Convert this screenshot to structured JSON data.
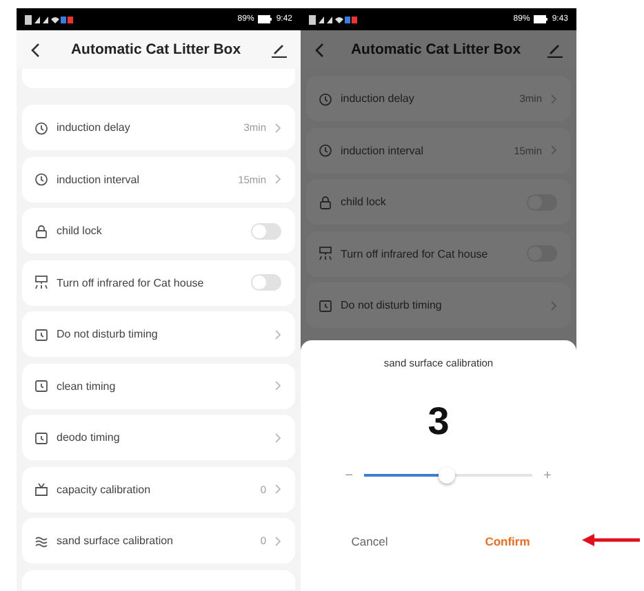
{
  "screens": [
    {
      "status": {
        "battery": "89%",
        "time": "9:42"
      },
      "title": "Automatic Cat Litter Box",
      "rows": [
        {
          "label": "induction delay",
          "kind": "value",
          "value": "3min"
        },
        {
          "label": "induction interval",
          "kind": "value",
          "value": "15min"
        },
        {
          "label": "child lock",
          "kind": "toggle",
          "on": false
        },
        {
          "label": "Turn off infrared for Cat house",
          "kind": "toggle",
          "on": false
        },
        {
          "label": "Do not disturb timing",
          "kind": "link"
        },
        {
          "label": "clean timing",
          "kind": "link"
        },
        {
          "label": "deodo timing",
          "kind": "link"
        },
        {
          "label": "capacity calibration",
          "kind": "value",
          "value": "0"
        },
        {
          "label": "sand surface calibration",
          "kind": "value",
          "value": "0"
        }
      ]
    },
    {
      "status": {
        "battery": "89%",
        "time": "9:43"
      },
      "title": "Automatic Cat Litter Box",
      "rows": [
        {
          "label": "induction delay",
          "kind": "value",
          "value": "3min"
        },
        {
          "label": "induction interval",
          "kind": "value",
          "value": "15min"
        },
        {
          "label": "child lock",
          "kind": "toggle",
          "on": false
        },
        {
          "label": "Turn off infrared for Cat house",
          "kind": "toggle",
          "on": false
        },
        {
          "label": "Do not disturb timing",
          "kind": "link"
        }
      ],
      "dialog": {
        "title": "sand surface calibration",
        "value": "3",
        "minus": "−",
        "plus": "+",
        "level": 0.49,
        "cancel": "Cancel",
        "confirm": "Confirm"
      }
    }
  ]
}
